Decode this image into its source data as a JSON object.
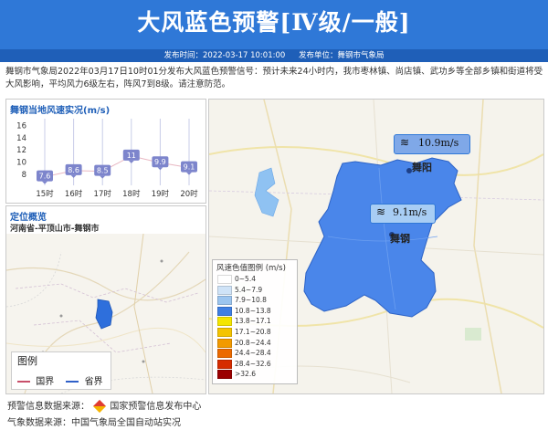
{
  "header": {
    "title": "大风蓝色预警[Ⅳ级/一般]",
    "publish_time": "发布时间：2022-03-17 10:01:00",
    "publish_unit": "发布单位：舞钢市气象局"
  },
  "description": "舞钢市气象局2022年03月17日10时01分发布大风蓝色预警信号：预计未来24小时内，我市枣林镇、尚店镇、武功乡等全部乡镇和街道将受大风影响，平均风力6级左右，阵风7到8级。请注意防范。",
  "wind_panel": {
    "title": "舞钢当地风速实况(m/s)",
    "chart_data": {
      "type": "line",
      "title": "舞钢当地风速实况(m/s)",
      "categories": [
        "15时",
        "16时",
        "17时",
        "18时",
        "19时",
        "20时"
      ],
      "values": [
        7.6,
        8.6,
        8.5,
        11,
        9.9,
        9.1
      ],
      "y_ticks": [
        8,
        10,
        12,
        14,
        16
      ],
      "ylim": [
        6.5,
        16.5
      ],
      "grid": false
    },
    "value_labels": [
      "7.6",
      "8.6",
      "8.5",
      "11",
      "9.9",
      "9.1"
    ]
  },
  "location_panel": {
    "title": "定位概览",
    "region": "河南省-平顶山市-舞钢市",
    "legend_title": "图例",
    "legend_items": [
      {
        "label": "国界",
        "color": "#c84f6a"
      },
      {
        "label": "省界",
        "color": "#2f60c8"
      }
    ]
  },
  "map": {
    "stations": [
      {
        "name": "舞阳",
        "speed": "10.9m/s",
        "color": "#7fa8e8"
      },
      {
        "name": "舞钢",
        "speed": "9.1m/s",
        "color": "#a8cdf4"
      }
    ],
    "legend_title": "风速色值图例 (m/s)",
    "legend": [
      {
        "label": "0~5.4",
        "color": "#ffffff"
      },
      {
        "label": "5.4~7.9",
        "color": "#cfe3f7"
      },
      {
        "label": "7.9~10.8",
        "color": "#9cc5ef"
      },
      {
        "label": "10.8~13.8",
        "color": "#3f7fe3"
      },
      {
        "label": "13.8~17.1",
        "color": "#f4e600"
      },
      {
        "label": "17.1~20.8",
        "color": "#f4c400"
      },
      {
        "label": "20.8~24.4",
        "color": "#f29a00"
      },
      {
        "label": "24.4~28.4",
        "color": "#ec6a00"
      },
      {
        "label": "28.4~32.6",
        "color": "#d62c00"
      },
      {
        "label": ">32.6",
        "color": "#9b0000"
      }
    ],
    "colors": {
      "region_fill": "#4a86ea",
      "region_edge": "#2d63c6",
      "water": "#8fc2f2",
      "road": "#f2e39a"
    }
  },
  "footer": {
    "warning_source": "预警信息数据来源：",
    "warning_source_name": "国家预警信息发布中心",
    "weather_source": "气象数据来源：中国气象局全国自动站实况"
  }
}
